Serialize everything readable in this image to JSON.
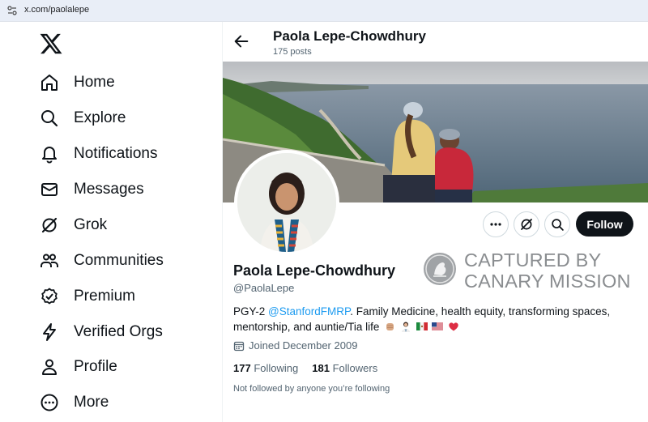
{
  "browser": {
    "url": "x.com/paolalepe"
  },
  "sidebar": {
    "items": [
      {
        "label": "Home",
        "icon": "home-icon"
      },
      {
        "label": "Explore",
        "icon": "search-icon"
      },
      {
        "label": "Notifications",
        "icon": "bell-icon"
      },
      {
        "label": "Messages",
        "icon": "envelope-icon"
      },
      {
        "label": "Grok",
        "icon": "grok-icon"
      },
      {
        "label": "Communities",
        "icon": "people-icon"
      },
      {
        "label": "Premium",
        "icon": "verified-badge-icon"
      },
      {
        "label": "Verified Orgs",
        "icon": "lightning-icon"
      },
      {
        "label": "Profile",
        "icon": "person-icon"
      },
      {
        "label": "More",
        "icon": "more-circle-icon"
      }
    ]
  },
  "header": {
    "name": "Paola Lepe-Chowdhury",
    "posts": "175 posts"
  },
  "profile": {
    "name": "Paola Lepe-Chowdhury",
    "handle": "@PaolaLepe",
    "bio_prefix": "PGY-2 ",
    "bio_link": "@StanfordFMRP",
    "bio_rest": ". Family Medicine, health equity, transforming spaces, mentorship, and auntie/Tia life",
    "joined": "Joined December 2009",
    "following_count": "177",
    "following_label": "Following",
    "followers_count": "181",
    "followers_label": "Followers",
    "not_followed": "Not followed by anyone you’re following",
    "follow_button": "Follow"
  },
  "watermark": {
    "line1": "CAPTURED BY",
    "line2": "CANARY MISSION"
  },
  "colors": {
    "accent": "#1d9bf0",
    "text": "#0f1419",
    "muted": "#536471"
  }
}
